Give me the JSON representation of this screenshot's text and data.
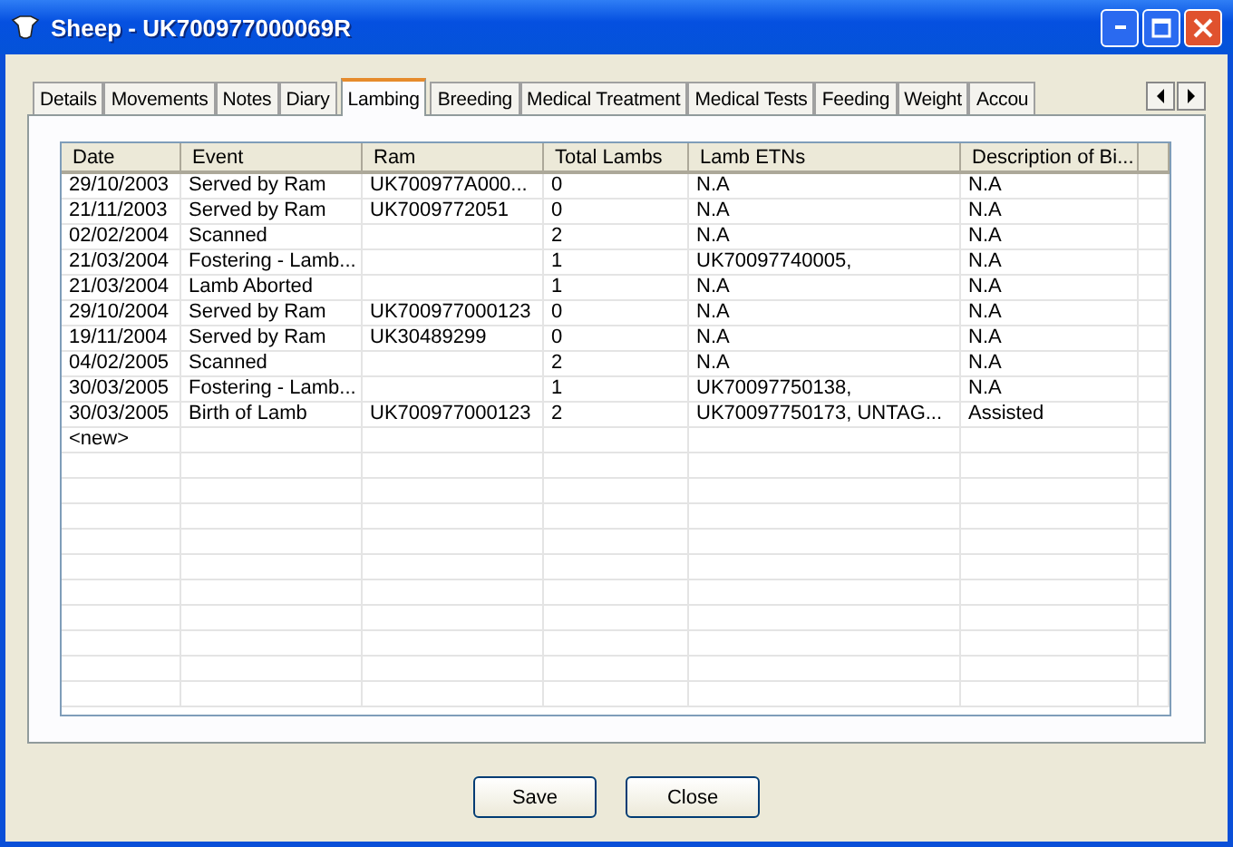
{
  "window": {
    "title": "Sheep - UK700977000069R"
  },
  "tabs": [
    {
      "label": "Details",
      "selected": false
    },
    {
      "label": "Movements",
      "selected": false
    },
    {
      "label": "Notes",
      "selected": false
    },
    {
      "label": "Diary",
      "selected": false
    },
    {
      "label": "Lambing",
      "selected": true
    },
    {
      "label": "Breeding",
      "selected": false
    },
    {
      "label": "Medical Treatment",
      "selected": false
    },
    {
      "label": "Medical Tests",
      "selected": false
    },
    {
      "label": "Feeding",
      "selected": false
    },
    {
      "label": "Weight",
      "selected": false
    },
    {
      "label": "Accou",
      "selected": false
    }
  ],
  "table": {
    "columns": [
      "Date",
      "Event",
      "Ram",
      "Total Lambs",
      "Lamb ETNs",
      "Description of Bi..."
    ],
    "rows": [
      [
        "29/10/2003",
        "Served by Ram",
        "UK700977A000...",
        "0",
        "N.A",
        "N.A"
      ],
      [
        "21/11/2003",
        "Served by Ram",
        "UK7009772051",
        "0",
        "N.A",
        "N.A"
      ],
      [
        "02/02/2004",
        "Scanned",
        "",
        "2",
        "N.A",
        "N.A"
      ],
      [
        "21/03/2004",
        "Fostering - Lamb...",
        "",
        "1",
        "UK70097740005,",
        "N.A"
      ],
      [
        "21/03/2004",
        "Lamb Aborted",
        "",
        "1",
        "N.A",
        "N.A"
      ],
      [
        "29/10/2004",
        "Served by Ram",
        "UK700977000123",
        "0",
        "N.A",
        "N.A"
      ],
      [
        "19/11/2004",
        "Served by Ram",
        "UK30489299",
        "0",
        "N.A",
        "N.A"
      ],
      [
        "04/02/2005",
        "Scanned",
        "",
        "2",
        "N.A",
        "N.A"
      ],
      [
        "30/03/2005",
        "Fostering - Lamb...",
        "",
        "1",
        "UK70097750138,",
        "N.A"
      ],
      [
        "30/03/2005",
        "Birth of Lamb",
        "UK700977000123",
        "2",
        "UK70097750173, UNTAG...",
        "Assisted"
      ]
    ],
    "new_row": "<new>"
  },
  "buttons": [
    "Save",
    "Close"
  ]
}
